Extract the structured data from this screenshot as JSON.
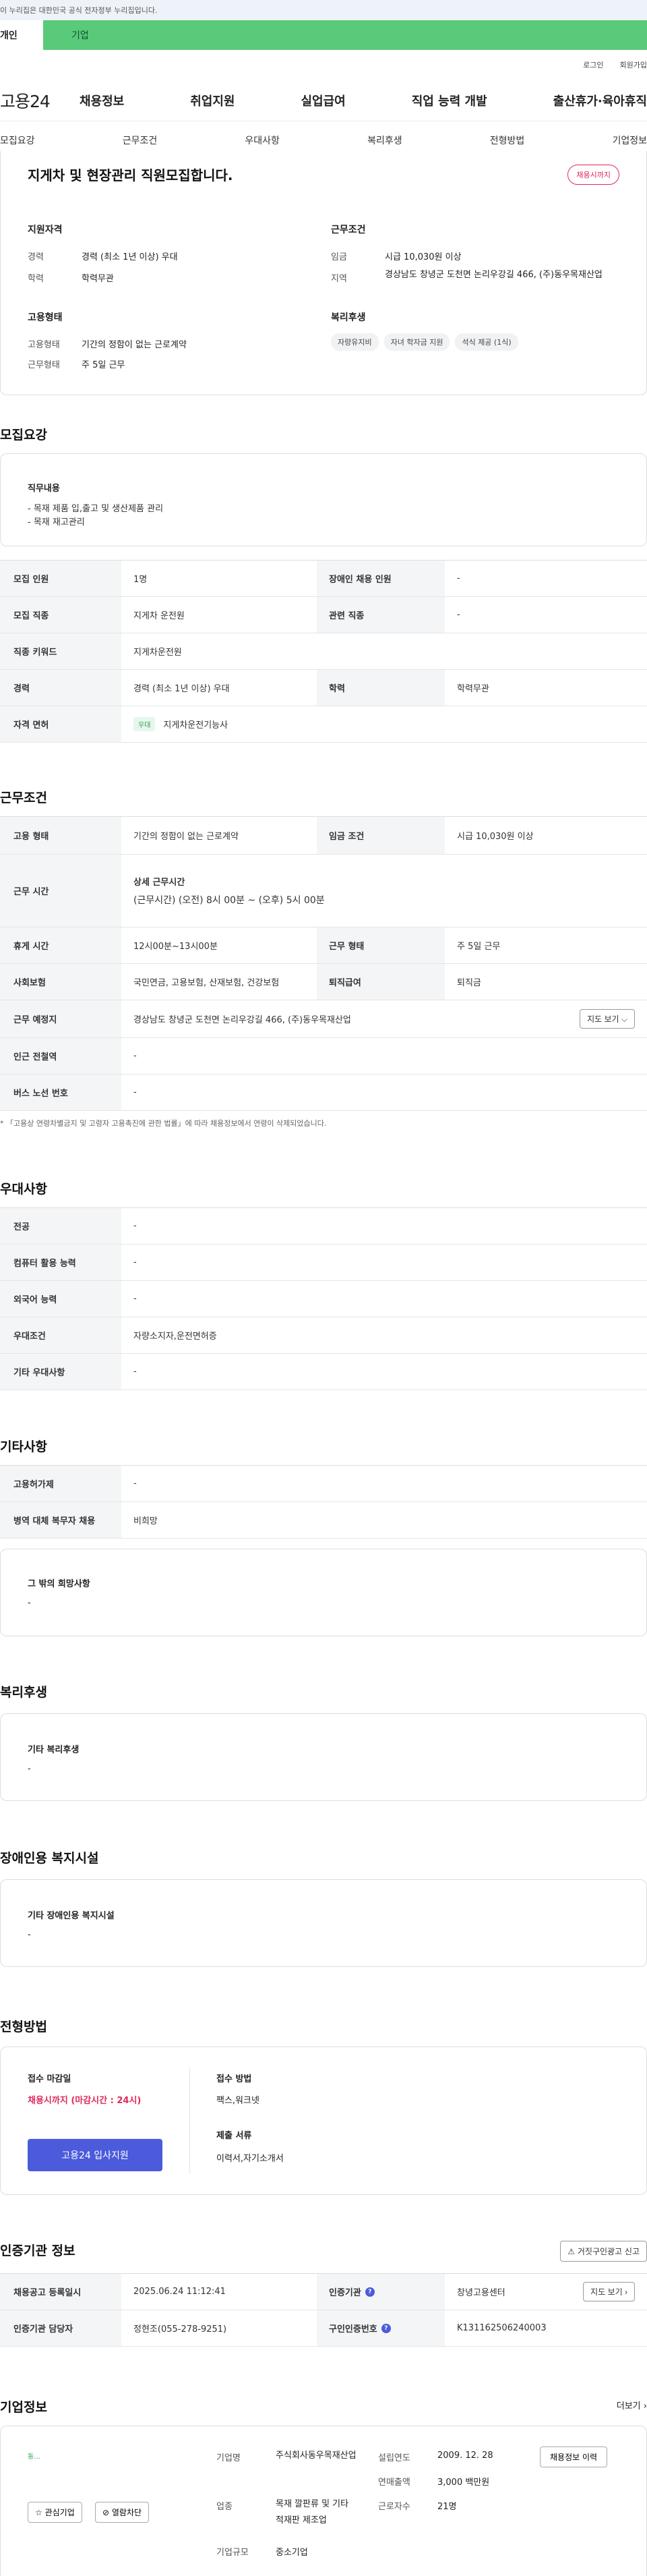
{
  "gov_notice": "이 누리집은 대한민국 공식 전자정부 누리집입니다.",
  "user_tabs": {
    "personal": "개인",
    "company": "기업"
  },
  "util_links": {
    "login": "로그인",
    "join": "회원가입"
  },
  "logo": "고용24",
  "gnb": [
    "채용정보",
    "취업지원",
    "실업급여",
    "직업 능력 개발",
    "출산휴가·육아휴직"
  ],
  "subnav": [
    "모집요강",
    "근무조건",
    "우대사항",
    "복리후생",
    "전형방법",
    "기업정보"
  ],
  "job": {
    "title": "지게차 및 현장관리 직원모집합니다.",
    "badge": "채용시까지"
  },
  "summary": {
    "qual_title": "지원자격",
    "career_label": "경력",
    "career_value": "경력 (최소 1년 이상) 우대",
    "edu_label": "학력",
    "edu_value": "학력무관",
    "cond_title": "근무조건",
    "wage_label": "임금",
    "wage_value": "시급 10,030원 이상",
    "region_label": "지역",
    "region_value": "경상남도 창녕군 도천면 논리우강길 466, (주)동우목재산업",
    "emp_title": "고용형태",
    "emptype_label": "고용형태",
    "emptype_value": "기간의 정함이 없는 근로계약",
    "worktype_label": "근무형태",
    "worktype_value": "주 5일 근무",
    "welfare_title": "복리후생",
    "welfare_tags": [
      "자량유지비",
      "자녀 학자금 지원",
      "석식 제공 (1식)"
    ]
  },
  "recruit": {
    "section_title": "모집요강",
    "duty_title": "직무내용",
    "duty_lines": [
      "- 목재 제품 입,출고 및 생산제품 관리",
      "- 목재 재고관리"
    ],
    "count_label": "모집 인원",
    "count_value": "1명",
    "disabled_label": "장애인 채용 인원",
    "disabled_value": "-",
    "job_label": "모집 직종",
    "job_value": "지게차 운전원",
    "related_label": "관련 직종",
    "related_value": "-",
    "keyword_label": "직종 키워드",
    "keyword_value": "지게차운전원",
    "career_label": "경력",
    "career_value": "경력 (최소 1년 이상) 우대",
    "edu_label": "학력",
    "edu_value": "학력무관",
    "license_label": "자격 면허",
    "license_badge": "우대",
    "license_value": "지게차운전기능사"
  },
  "work": {
    "section_title": "근무조건",
    "emptype_label": "고용 형태",
    "emptype_value": "기간의 정함이 없는 근로계약",
    "wage_label": "임금 조건",
    "wage_value": "시급 10,030원 이상",
    "hours_label": "근무 시간",
    "hours_title": "상세 근무시간",
    "hours_value": "(근무시간) (오전) 8시 00분 ~ (오후) 5시 00분",
    "break_label": "휴게 시간",
    "break_value": "12시00분~13시00분",
    "worktype_label": "근무 형태",
    "worktype_value": "주 5일 근무",
    "insurance_label": "사회보험",
    "insurance_value": "국민연금, 고용보험, 산재보험, 건강보험",
    "severance_label": "퇴직급여",
    "severance_value": "퇴직금",
    "place_label": "근무 예정지",
    "place_value": "경상남도 창녕군 도천면 논리우강길 466, (주)동우목재산업",
    "map_button": "지도 보기 ⌵",
    "subway_label": "인근 전철역",
    "subway_value": "-",
    "bus_label": "버스 노선 번호",
    "bus_value": "-",
    "note": "* 「고용상 연령차별금지 및 고령자 고용촉진에 관한 법률」에 따라 채용정보에서 연령이 삭제되었습니다."
  },
  "pref": {
    "section_title": "우대사항",
    "major_label": "전공",
    "major_value": "-",
    "pc_label": "컴퓨터 활용 능력",
    "pc_value": "-",
    "lang_label": "외국어 능력",
    "lang_value": "-",
    "cond_label": "우대조건",
    "cond_value": "자량소지자,운전면허증",
    "etc_label": "기타 우대사항",
    "etc_value": "-"
  },
  "etc": {
    "section_title": "기타사항",
    "employ_label": "고용허가제",
    "employ_value": "-",
    "military_label": "병역 대체 복무자 채용",
    "military_value": "비희망",
    "hope_title": "그 밖의 희망사항",
    "hope_value": "-"
  },
  "welfare": {
    "section_title": "복리후생",
    "box_title": "기타 복리후생",
    "box_value": "-"
  },
  "disabled": {
    "section_title": "장애인용 복지시설",
    "box_title": "기타 장애인용 복지시설",
    "box_value": "-"
  },
  "selection": {
    "section_title": "전형방법",
    "deadline_label": "접수 마감일",
    "deadline_value": "채용시까지 (마감시간 : 24시)",
    "apply_button": "고용24 입사지원",
    "method_label": "접수 방법",
    "method_value": "팩스,워크넷",
    "docs_label": "제출 서류",
    "docs_value": "이력서,자기소개서"
  },
  "cert": {
    "section_title": "인증기관 정보",
    "report_button": "거짓구인광고 신고",
    "reg_label": "채용공고 등록일시",
    "reg_value": "2025.06.24 11:12:41",
    "agency_label": "인증기관",
    "agency_value": "창녕고용센터",
    "map_button": "지도 보기",
    "manager_label": "인증기관 담당자",
    "manager_value": "정현조(055-278-9251)",
    "jobno_label": "구인인증번호",
    "jobno_value": "K131162506240003"
  },
  "company": {
    "section_title": "기업정보",
    "more": "더보기",
    "logo_text": "동...",
    "fav_button": "관심기업",
    "block_button": "열람차단",
    "name_label": "기업명",
    "name_value": "주식회사동우목재산업",
    "industry_label": "업종",
    "industry_value": "목재 깔판류 및 기타 적재판 제조업",
    "scale_label": "기업규모",
    "scale_value": "중소기업",
    "founded_label": "설립연도",
    "founded_value": "2009. 12. 28",
    "sales_label": "연매출액",
    "sales_value": "3,000 백만원",
    "staff_label": "근로자수",
    "staff_value": "21명",
    "history_button": "채용정보 이력"
  },
  "colors": {
    "accent": "#59c97a",
    "primary": "#4b5bdc",
    "badge": "#e0295a"
  }
}
